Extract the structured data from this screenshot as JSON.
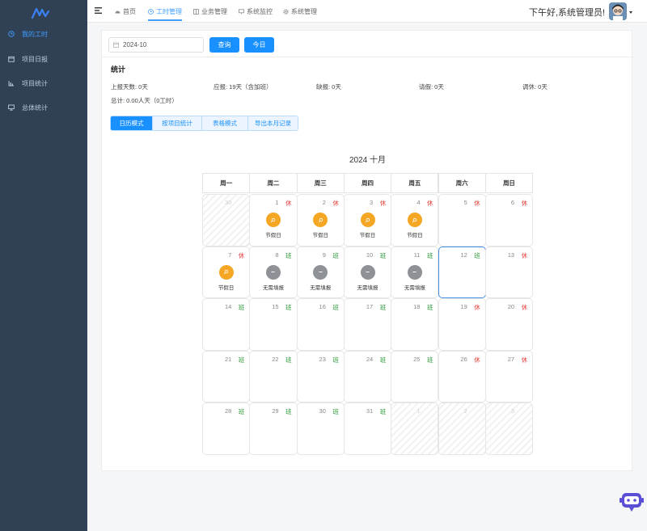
{
  "sidebar": {
    "items": [
      {
        "label": "我的工时",
        "icon": "clock-icon",
        "active": true
      },
      {
        "label": "项目日报",
        "icon": "calendar-icon",
        "active": false
      },
      {
        "label": "项目统计",
        "icon": "chart-icon",
        "active": false
      },
      {
        "label": "总体统计",
        "icon": "monitor-icon",
        "active": false
      }
    ]
  },
  "topnav": {
    "items": [
      {
        "label": "首页",
        "icon": "dashboard-icon"
      },
      {
        "label": "工时管理",
        "icon": "clock-icon",
        "active": true
      },
      {
        "label": "业务管理",
        "icon": "grid-icon"
      },
      {
        "label": "系统监控",
        "icon": "monitor-icon"
      },
      {
        "label": "系统管理",
        "icon": "gear-icon"
      }
    ],
    "greeting": "下午好,系统管理员!"
  },
  "toolbar": {
    "month_value": "2024-10",
    "query_label": "查询",
    "today_label": "今日"
  },
  "stats": {
    "title": "统计",
    "reported_days": "上报天数:  0天",
    "required": "应报:  19天（含加班）",
    "missing": "缺报:  0天",
    "leave": "请假:  0天",
    "rest": "调休:  0天",
    "total": "总计:  0.00人天（0工时）"
  },
  "tabs": [
    "日历模式",
    "按项目统计",
    "表格模式",
    "导出本月记录"
  ],
  "calendar": {
    "title": "2024 十月",
    "weekdays": [
      "周一",
      "周二",
      "周三",
      "周四",
      "周五",
      "周六",
      "周日"
    ],
    "days": [
      {
        "n": "30",
        "other": true,
        "tag": "",
        "status": ""
      },
      {
        "n": "1",
        "tag": "休",
        "status": "holiday",
        "label": "节假日"
      },
      {
        "n": "2",
        "tag": "休",
        "status": "holiday",
        "label": "节假日"
      },
      {
        "n": "3",
        "tag": "休",
        "status": "holiday",
        "label": "节假日"
      },
      {
        "n": "4",
        "tag": "休",
        "status": "holiday",
        "label": "节假日"
      },
      {
        "n": "5",
        "tag": "休",
        "status": ""
      },
      {
        "n": "6",
        "tag": "休",
        "status": ""
      },
      {
        "n": "7",
        "tag": "休",
        "status": "holiday",
        "label": "节假日"
      },
      {
        "n": "8",
        "tag": "班",
        "status": "none",
        "label": "无需填报"
      },
      {
        "n": "9",
        "tag": "班",
        "status": "none",
        "label": "无需填报"
      },
      {
        "n": "10",
        "tag": "班",
        "status": "none",
        "label": "无需填报"
      },
      {
        "n": "11",
        "tag": "班",
        "status": "none",
        "label": "无需填报"
      },
      {
        "n": "12",
        "tag": "班",
        "status": "",
        "today": true
      },
      {
        "n": "13",
        "tag": "休",
        "status": ""
      },
      {
        "n": "14",
        "tag": "班",
        "status": ""
      },
      {
        "n": "15",
        "tag": "班",
        "status": ""
      },
      {
        "n": "16",
        "tag": "班",
        "status": ""
      },
      {
        "n": "17",
        "tag": "班",
        "status": ""
      },
      {
        "n": "18",
        "tag": "班",
        "status": ""
      },
      {
        "n": "19",
        "tag": "休",
        "status": ""
      },
      {
        "n": "20",
        "tag": "休",
        "status": ""
      },
      {
        "n": "21",
        "tag": "班",
        "status": ""
      },
      {
        "n": "22",
        "tag": "班",
        "status": ""
      },
      {
        "n": "23",
        "tag": "班",
        "status": ""
      },
      {
        "n": "24",
        "tag": "班",
        "status": ""
      },
      {
        "n": "25",
        "tag": "班",
        "status": ""
      },
      {
        "n": "26",
        "tag": "休",
        "status": ""
      },
      {
        "n": "27",
        "tag": "休",
        "status": ""
      },
      {
        "n": "28",
        "tag": "班",
        "status": ""
      },
      {
        "n": "29",
        "tag": "班",
        "status": ""
      },
      {
        "n": "30",
        "tag": "班",
        "status": ""
      },
      {
        "n": "31",
        "tag": "班",
        "status": ""
      },
      {
        "n": "1",
        "other": true,
        "tag": "",
        "status": ""
      },
      {
        "n": "2",
        "other": true,
        "tag": "",
        "status": ""
      },
      {
        "n": "3",
        "other": true,
        "tag": "",
        "status": ""
      }
    ]
  },
  "colors": {
    "sidebar_bg": "#304156",
    "accent": "#1890ff",
    "rest_tag": "#e53935",
    "work_tag": "#2e9b3a",
    "holiday_icon": "#f5a623",
    "none_icon": "#8e9196"
  }
}
